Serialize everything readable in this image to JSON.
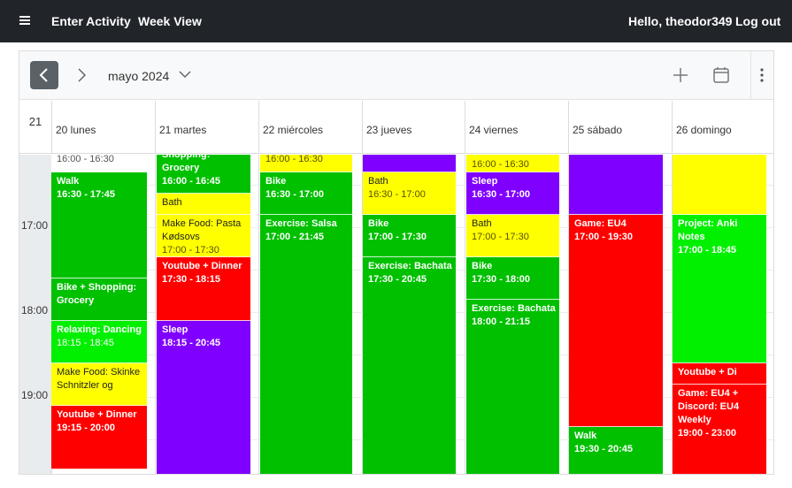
{
  "navbar": {
    "menu_icon": "hamburger-icon",
    "enter_activity": "Enter Activity",
    "week_view": "Week View",
    "greeting": "Hello, theodor349",
    "logout": "Log out"
  },
  "calendar": {
    "month_label": "mayo 2024",
    "week_number": "21",
    "days": [
      "20 lunes",
      "21 martes",
      "22 miércoles",
      "23 jueves",
      "24 viernes",
      "25 sábado",
      "26 domingo"
    ],
    "time_labels": [
      "17:00",
      "18:00",
      "19:00"
    ],
    "colors": {
      "green": "#00c000",
      "lime": "#00f000",
      "yellow": "#ffff00",
      "red": "#ff0000",
      "purple": "#8000ff"
    },
    "events": {
      "mon": [
        {
          "title": "",
          "time": "16:00 - 16:30"
        },
        {
          "title": "Walk",
          "time": "16:30 - 17:45"
        },
        {
          "title": "Bike + Shopping: Grocery",
          "time": ""
        },
        {
          "title": "Relaxing: Dancing",
          "time": "18:15 - 18:45"
        },
        {
          "title": "Make Food: Skinke Schnitzler og",
          "time": ""
        },
        {
          "title": "Youtube + Dinner",
          "time": "19:15 - 20:00"
        }
      ],
      "tue": [
        {
          "title": "Shopping: Grocery",
          "time": "16:00 - 16:45"
        },
        {
          "title": "Bath",
          "time": ""
        },
        {
          "title": "Make Food: Pasta Kødsovs",
          "time": "17:00 - 17:30"
        },
        {
          "title": "Youtube + Dinner",
          "time": "17:30 - 18:15"
        },
        {
          "title": "Sleep",
          "time": "18:15 - 20:45"
        }
      ],
      "wed": [
        {
          "title": "",
          "time": "16:00 - 16:30"
        },
        {
          "title": "Bike",
          "time": "16:30 - 17:00"
        },
        {
          "title": "Exercise: Salsa",
          "time": "17:00 - 21:45"
        }
      ],
      "thu": [
        {
          "title": "",
          "time": ""
        },
        {
          "title": "Bath",
          "time": "16:30 - 17:00"
        },
        {
          "title": "Bike",
          "time": "17:00 - 17:30"
        },
        {
          "title": "Exercise: Bachata",
          "time": "17:30 - 20:45"
        }
      ],
      "fri": [
        {
          "title": "",
          "time": "16:00 - 16:30"
        },
        {
          "title": "Sleep",
          "time": "16:30 - 17:00"
        },
        {
          "title": "Bath",
          "time": "17:00 - 17:30"
        },
        {
          "title": "Bike",
          "time": "17:30 - 18:00"
        },
        {
          "title": "Exercise: Bachata",
          "time": "18:00 - 21:15"
        }
      ],
      "sat": [
        {
          "title": "",
          "time": ""
        },
        {
          "title": "Game: EU4",
          "time": "17:00 - 19:30"
        },
        {
          "title": "Walk",
          "time": "19:30 - 20:45"
        }
      ],
      "sun": [
        {
          "title": "",
          "time": ""
        },
        {
          "title": "Project: Anki Notes",
          "time": "17:00 - 18:45"
        },
        {
          "title": "Youtube + Di",
          "time": ""
        },
        {
          "title": "Game: EU4 + Discord: EU4 Weekly",
          "time": "19:00 - 23:00"
        }
      ]
    }
  }
}
